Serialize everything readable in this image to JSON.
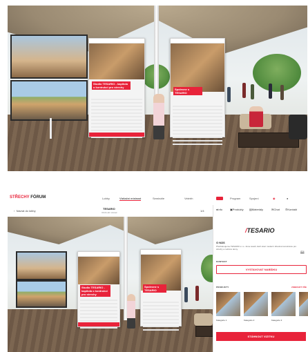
{
  "colors": {
    "brand": "#e8233a"
  },
  "booth": {
    "board_left_caption": "Studio TESARIO - kapitola o kontrukci pro strechy",
    "board_right_caption": "Spolecne s TESARIO",
    "board_logo": "TESARIO"
  },
  "nav": {
    "logo_brand": "STŘECHY",
    "logo_suffix": "FÓRUM",
    "items": [
      "Lobby",
      "Vizitační místnost",
      "Semináře",
      "Veletrh",
      "Program",
      "Spojení"
    ]
  },
  "subheader": {
    "back": "Návrat do lobby",
    "title": "TESARIO",
    "subtitle": "Obchodní stánek",
    "count": "1/4"
  },
  "panel": {
    "tabs": [
      "Info",
      "Produkty",
      "Materiály",
      "Chat",
      "Kontakt"
    ],
    "logo": "TESARIO",
    "about_title": "O NÁS",
    "about_text": "Představujeme TESARIO s.r.o. Jsme tesaři, kteří staví moderní dřevěné konstrukce pro střechy a rodinné domy.",
    "more_link": "více",
    "contact_label": "KONTAKT",
    "contact_button": "VYSTAVOVAT NABÍDKU",
    "products_label": "PRODUKTY",
    "all_link": "ZOBRAZIT VŠE",
    "products": [
      "Kategorie 1",
      "Kategorie 2",
      "Kategorie 3"
    ],
    "cta": "STÁHNOUT VIZITKU"
  }
}
